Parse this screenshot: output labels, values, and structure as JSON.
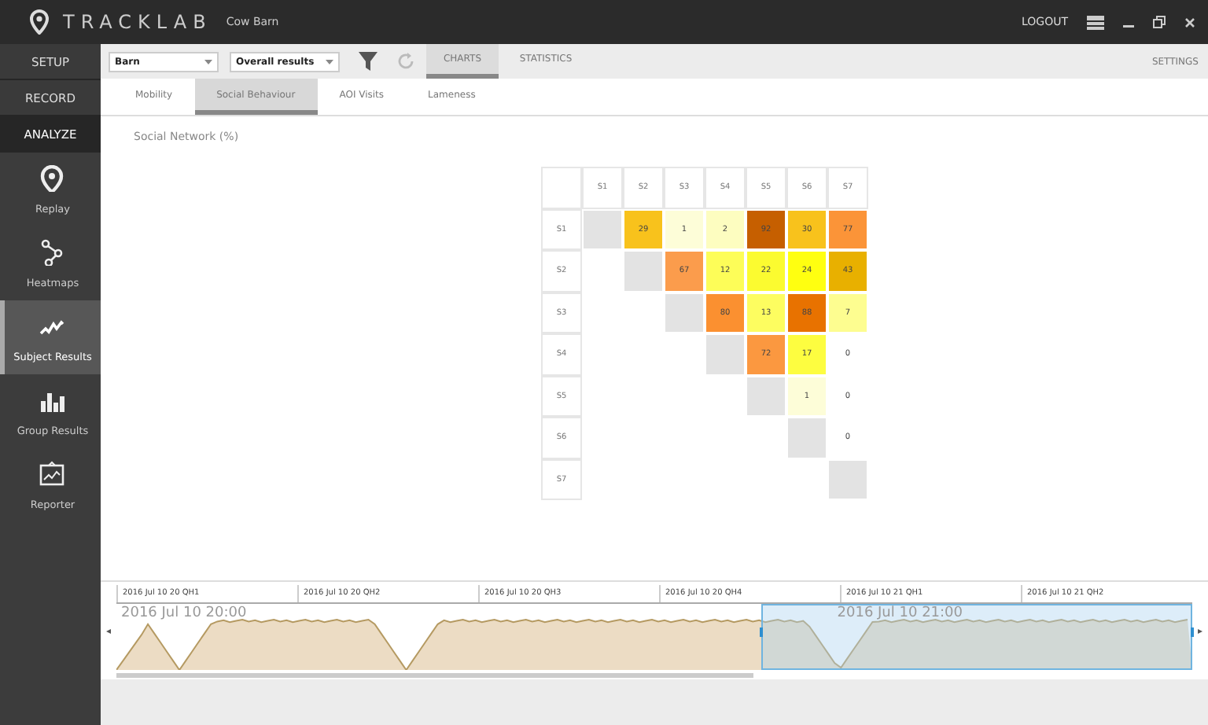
{
  "window": {
    "app_name": "TRACKLAB",
    "subtitle": "Cow Barn",
    "logout": "LOGOUT"
  },
  "sidebar": {
    "sections": [
      {
        "label": "SETUP",
        "selected": false
      },
      {
        "label": "RECORD",
        "selected": false
      },
      {
        "label": "ANALYZE",
        "selected": true
      }
    ],
    "items": [
      {
        "label": "Replay",
        "kind": "pin",
        "selected": false
      },
      {
        "label": "Heatmaps",
        "kind": "path",
        "selected": false
      },
      {
        "label": "Subject Results",
        "kind": "zigzag",
        "selected": true
      },
      {
        "label": "Group Results",
        "kind": "bars",
        "selected": false
      },
      {
        "label": "Reporter",
        "kind": "board",
        "selected": false
      }
    ]
  },
  "toolbar": {
    "dropdowns": [
      {
        "value": "Barn"
      },
      {
        "value": "Overall results"
      }
    ],
    "tabs": [
      {
        "label": "CHARTS",
        "selected": true
      },
      {
        "label": "STATISTICS",
        "selected": false
      }
    ],
    "settings": "SETTINGS"
  },
  "subtabs": [
    {
      "label": "Mobility",
      "selected": false
    },
    {
      "label": "Social Behaviour",
      "selected": true
    },
    {
      "label": "AOI Visits",
      "selected": false
    },
    {
      "label": "Lameness",
      "selected": false
    }
  ],
  "matrix": {
    "title": "Social Network (%)",
    "columns": [
      "S1",
      "S2",
      "S3",
      "S4",
      "S5",
      "S6",
      "S7"
    ],
    "rows": [
      {
        "label": "S1",
        "cells": [
          {
            "kind": "diagonal"
          },
          {
            "kind": "value",
            "value": "29",
            "color": "#f8c21c"
          },
          {
            "kind": "value",
            "value": "1",
            "color": "#fdfdd8"
          },
          {
            "kind": "value",
            "value": "2",
            "color": "#fdfdc0"
          },
          {
            "kind": "value",
            "value": "92",
            "color": "#c65f00"
          },
          {
            "kind": "value",
            "value": "30",
            "color": "#f8c21c"
          },
          {
            "kind": "value",
            "value": "77",
            "color": "#fb9438"
          }
        ]
      },
      {
        "label": "S2",
        "cells": [
          {
            "kind": "empty"
          },
          {
            "kind": "diagonal"
          },
          {
            "kind": "value",
            "value": "67",
            "color": "#fb9c4c"
          },
          {
            "kind": "value",
            "value": "12",
            "color": "#fdfd58"
          },
          {
            "kind": "value",
            "value": "22",
            "color": "#fbfb30"
          },
          {
            "kind": "value",
            "value": "24",
            "color": "#ffff10"
          },
          {
            "kind": "value",
            "value": "43",
            "color": "#e8b000"
          }
        ]
      },
      {
        "label": "S3",
        "cells": [
          {
            "kind": "empty"
          },
          {
            "kind": "empty"
          },
          {
            "kind": "diagonal"
          },
          {
            "kind": "value",
            "value": "80",
            "color": "#fb9030"
          },
          {
            "kind": "value",
            "value": "13",
            "color": "#fdfd60"
          },
          {
            "kind": "value",
            "value": "88",
            "color": "#e87200"
          },
          {
            "kind": "value",
            "value": "7",
            "color": "#fdfd90"
          }
        ]
      },
      {
        "label": "S4",
        "cells": [
          {
            "kind": "empty"
          },
          {
            "kind": "empty"
          },
          {
            "kind": "empty"
          },
          {
            "kind": "diagonal"
          },
          {
            "kind": "value",
            "value": "72",
            "color": "#fb9840"
          },
          {
            "kind": "value",
            "value": "17",
            "color": "#fdfd40"
          },
          {
            "kind": "value",
            "value": "0",
            "color": "#ffffff"
          }
        ]
      },
      {
        "label": "S5",
        "cells": [
          {
            "kind": "empty"
          },
          {
            "kind": "empty"
          },
          {
            "kind": "empty"
          },
          {
            "kind": "empty"
          },
          {
            "kind": "diagonal"
          },
          {
            "kind": "value",
            "value": "1",
            "color": "#fdfdd8"
          },
          {
            "kind": "value",
            "value": "0",
            "color": "#ffffff"
          }
        ]
      },
      {
        "label": "S6",
        "cells": [
          {
            "kind": "empty"
          },
          {
            "kind": "empty"
          },
          {
            "kind": "empty"
          },
          {
            "kind": "empty"
          },
          {
            "kind": "empty"
          },
          {
            "kind": "diagonal"
          },
          {
            "kind": "value",
            "value": "0",
            "color": "#ffffff"
          }
        ]
      },
      {
        "label": "S7",
        "cells": [
          {
            "kind": "empty"
          },
          {
            "kind": "empty"
          },
          {
            "kind": "empty"
          },
          {
            "kind": "empty"
          },
          {
            "kind": "empty"
          },
          {
            "kind": "empty"
          },
          {
            "kind": "diagonal"
          }
        ]
      }
    ]
  },
  "timeline": {
    "ticks": [
      "2016 Jul 10 20 QH1",
      "2016 Jul 10 20 QH2",
      "2016 Jul 10 20 QH3",
      "2016 Jul 10 20 QH4",
      "2016 Jul 10 21 QH1",
      "2016 Jul 10 21 QH2"
    ],
    "hours": [
      "2016 Jul 10 20:00",
      "2016 Jul 10 21:00"
    ],
    "prev": "◂",
    "next": "▸"
  }
}
